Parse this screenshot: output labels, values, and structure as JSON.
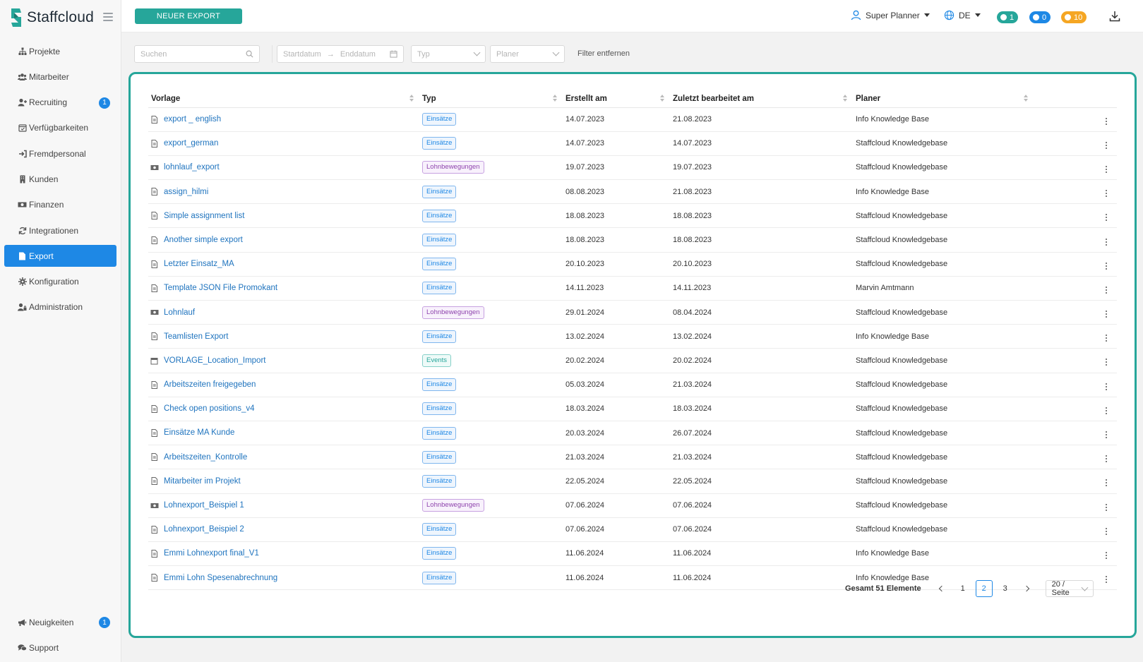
{
  "app": {
    "logo_text": "Staffcloud"
  },
  "colors": {
    "accent": "#26a69a",
    "primary": "#1e88e5",
    "warning": "#f5a623"
  },
  "sidebar": {
    "items": [
      {
        "label": "Projekte",
        "icon": "sitemap-icon"
      },
      {
        "label": "Mitarbeiter",
        "icon": "users-icon"
      },
      {
        "label": "Recruiting",
        "icon": "user-plus-icon",
        "badge": "1"
      },
      {
        "label": "Verfügbarkeiten",
        "icon": "calendar-check-icon"
      },
      {
        "label": "Fremdpersonal",
        "icon": "sign-in-icon"
      },
      {
        "label": "Kunden",
        "icon": "building-icon"
      },
      {
        "label": "Finanzen",
        "icon": "money-icon"
      },
      {
        "label": "Integrationen",
        "icon": "sync-icon"
      },
      {
        "label": "Export",
        "icon": "file-icon",
        "active": true
      },
      {
        "label": "Konfiguration",
        "icon": "gear-icon"
      },
      {
        "label": "Administration",
        "icon": "user-lock-icon"
      }
    ],
    "bottom": [
      {
        "label": "Neuigkeiten",
        "icon": "megaphone-icon",
        "badge": "1"
      },
      {
        "label": "Support",
        "icon": "comments-icon"
      }
    ]
  },
  "header": {
    "new_export_label": "NEUER EXPORT",
    "user_name": "Super Planner",
    "language": "DE",
    "chat_count": "1",
    "notification_count": "0",
    "timer_count": "10"
  },
  "filters": {
    "search_placeholder": "Suchen",
    "start_date_placeholder": "Startdatum",
    "end_date_placeholder": "Enddatum",
    "type_placeholder": "Typ",
    "planer_placeholder": "Planer",
    "remove_label": "Filter entfernen"
  },
  "table": {
    "columns": [
      "Vorlage",
      "Typ",
      "Erstellt am",
      "Zuletzt bearbeitet am",
      "Planer"
    ],
    "rows": [
      {
        "name": "export _ english",
        "type": "Einsätze",
        "created": "14.07.2023",
        "edited": "21.08.2023",
        "planer": "Info Knowledge Base"
      },
      {
        "name": "export_german",
        "type": "Einsätze",
        "created": "14.07.2023",
        "edited": "14.07.2023",
        "planer": "Staffcloud Knowledgebase"
      },
      {
        "name": "lohnlauf_export",
        "type": "Lohnbewegungen",
        "created": "19.07.2023",
        "edited": "19.07.2023",
        "planer": "Staffcloud Knowledgebase"
      },
      {
        "name": "assign_hilmi",
        "type": "Einsätze",
        "created": "08.08.2023",
        "edited": "21.08.2023",
        "planer": "Info Knowledge Base"
      },
      {
        "name": "Simple assignment list",
        "type": "Einsätze",
        "created": "18.08.2023",
        "edited": "18.08.2023",
        "planer": "Staffcloud Knowledgebase"
      },
      {
        "name": "Another simple export",
        "type": "Einsätze",
        "created": "18.08.2023",
        "edited": "18.08.2023",
        "planer": "Staffcloud Knowledgebase"
      },
      {
        "name": "Letzter Einsatz_MA",
        "type": "Einsätze",
        "created": "20.10.2023",
        "edited": "20.10.2023",
        "planer": "Staffcloud Knowledgebase"
      },
      {
        "name": "Template JSON File Promokant",
        "type": "Einsätze",
        "created": "14.11.2023",
        "edited": "14.11.2023",
        "planer": "Marvin Amtmann"
      },
      {
        "name": "Lohnlauf",
        "type": "Lohnbewegungen",
        "created": "29.01.2024",
        "edited": "08.04.2024",
        "planer": "Staffcloud Knowledgebase"
      },
      {
        "name": "Teamlisten Export",
        "type": "Einsätze",
        "created": "13.02.2024",
        "edited": "13.02.2024",
        "planer": "Info Knowledge Base"
      },
      {
        "name": "VORLAGE_Location_Import",
        "type": "Events",
        "created": "20.02.2024",
        "edited": "20.02.2024",
        "planer": "Staffcloud Knowledgebase"
      },
      {
        "name": "Arbeitszeiten freigegeben",
        "type": "Einsätze",
        "created": "05.03.2024",
        "edited": "21.03.2024",
        "planer": "Staffcloud Knowledgebase"
      },
      {
        "name": "Check open positions_v4",
        "type": "Einsätze",
        "created": "18.03.2024",
        "edited": "18.03.2024",
        "planer": "Staffcloud Knowledgebase"
      },
      {
        "name": "Einsätze MA Kunde",
        "type": "Einsätze",
        "created": "20.03.2024",
        "edited": "26.07.2024",
        "planer": "Staffcloud Knowledgebase"
      },
      {
        "name": "Arbeitszeiten_Kontrolle",
        "type": "Einsätze",
        "created": "21.03.2024",
        "edited": "21.03.2024",
        "planer": "Staffcloud Knowledgebase"
      },
      {
        "name": "Mitarbeiter im Projekt",
        "type": "Einsätze",
        "created": "22.05.2024",
        "edited": "22.05.2024",
        "planer": "Staffcloud Knowledgebase"
      },
      {
        "name": "Lohnexport_Beispiel 1",
        "type": "Lohnbewegungen",
        "created": "07.06.2024",
        "edited": "07.06.2024",
        "planer": "Staffcloud Knowledgebase"
      },
      {
        "name": "Lohnexport_Beispiel 2",
        "type": "Einsätze",
        "created": "07.06.2024",
        "edited": "07.06.2024",
        "planer": "Staffcloud Knowledgebase"
      },
      {
        "name": "Emmi Lohnexport final_V1",
        "type": "Einsätze",
        "created": "11.06.2024",
        "edited": "11.06.2024",
        "planer": "Info Knowledge Base"
      },
      {
        "name": "Emmi Lohn Spesenabrechnung",
        "type": "Einsätze",
        "created": "11.06.2024",
        "edited": "11.06.2024",
        "planer": "Info Knowledge Base"
      }
    ]
  },
  "pagination": {
    "total_label": "Gesamt 51 Elemente",
    "pages": [
      "1",
      "2",
      "3"
    ],
    "current_page": "2",
    "page_size": "20 / Seite"
  }
}
